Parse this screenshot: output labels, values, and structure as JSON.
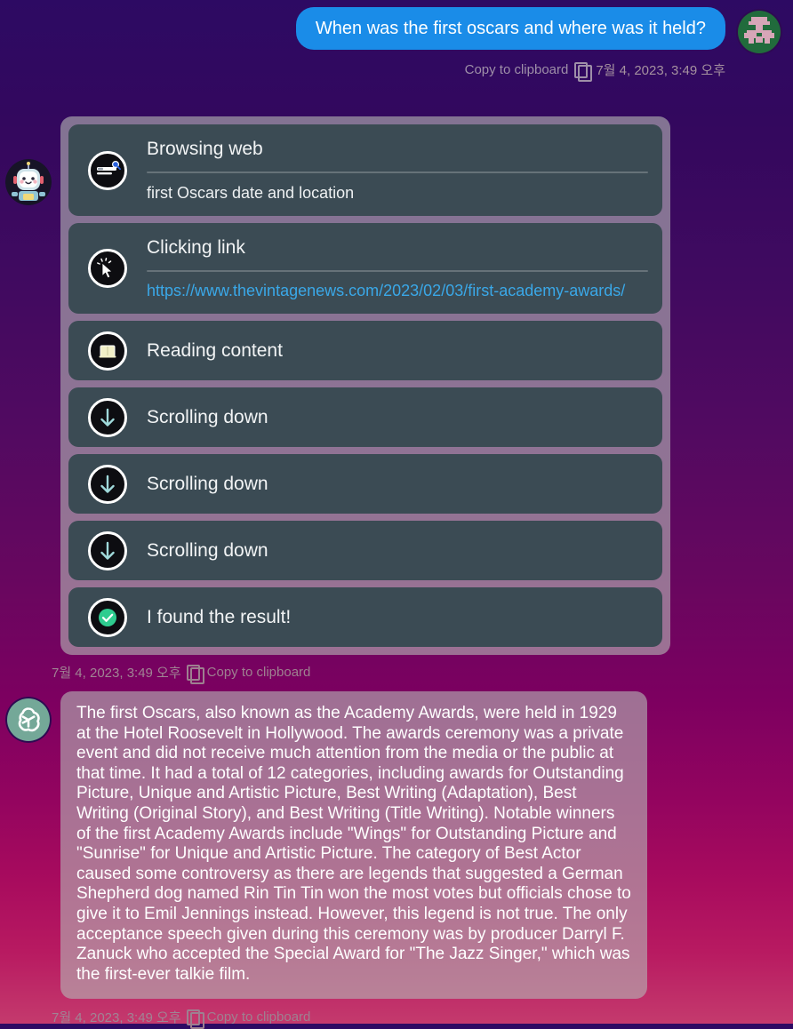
{
  "conversation": {
    "user_message": {
      "text": "When was the first oscars and where was it held?",
      "copy_label": "Copy to clipboard",
      "timestamp": "7월 4, 2023, 3:49 오후",
      "avatar_icon": "pixel-invader-avatar-icon",
      "bubble_color": "#1a8ce8"
    },
    "tool_run": {
      "avatar_icon": "robot-avatar-icon",
      "copy_label": "Copy to clipboard",
      "timestamp": "7월 4, 2023, 3:49 오후",
      "steps": [
        {
          "title": "Browsing web",
          "icon": "browsing-search-icon",
          "sub_text": "first Oscars date and location",
          "sub_type": "text",
          "has_divider": true
        },
        {
          "title": "Clicking link",
          "icon": "click-cursor-icon",
          "sub_text": "https://www.thevintagenews.com/2023/02/03/first-academy-awards/",
          "sub_type": "link",
          "has_divider": true
        },
        {
          "title": "Reading content",
          "icon": "reading-book-icon",
          "sub_text": "",
          "sub_type": "none",
          "has_divider": false
        },
        {
          "title": "Scrolling down",
          "icon": "arrow-down-icon",
          "sub_text": "",
          "sub_type": "none",
          "has_divider": false
        },
        {
          "title": "Scrolling down",
          "icon": "arrow-down-icon",
          "sub_text": "",
          "sub_type": "none",
          "has_divider": false
        },
        {
          "title": "Scrolling down",
          "icon": "arrow-down-icon",
          "sub_text": "",
          "sub_type": "none",
          "has_divider": false
        },
        {
          "title": "I found the result!",
          "icon": "check-circle-icon",
          "sub_text": "",
          "sub_type": "none",
          "has_divider": false
        }
      ]
    },
    "assistant_answer": {
      "avatar_icon": "openai-logo-icon",
      "text": "The first Oscars, also known as the Academy Awards, were held in 1929 at the Hotel Roosevelt in Hollywood. The awards ceremony was a private event and did not receive much attention from the media or the public at that time. It had a total of 12 categories, including awards for Outstanding Picture, Unique and Artistic Picture, Best Writing (Adaptation), Best Writing (Original Story), and Best Writing (Title Writing). Notable winners of the first Academy Awards include \"Wings\" for Outstanding Picture and \"Sunrise\" for Unique and Artistic Picture. The category of Best Actor caused some controversy as there are legends that suggested a German Shepherd dog named Rin Tin Tin won the most votes but officials chose to give it to Emil Jennings instead. However, this legend is not true. The only acceptance speech given during this ceremony was by producer Darryl F. Zanuck who accepted the Special Award for \"The Jazz Singer,\" which was the first-ever talkie film.",
      "copy_label": "Copy to clipboard",
      "timestamp": "7월 4, 2023, 3:49 오후"
    }
  },
  "theme": {
    "background_top": "#2d0a63",
    "background_bottom": "#c43a6d",
    "card_background": "#3b4b54",
    "link_color": "#3aa8e8",
    "success_color": "#2ecc8f"
  }
}
